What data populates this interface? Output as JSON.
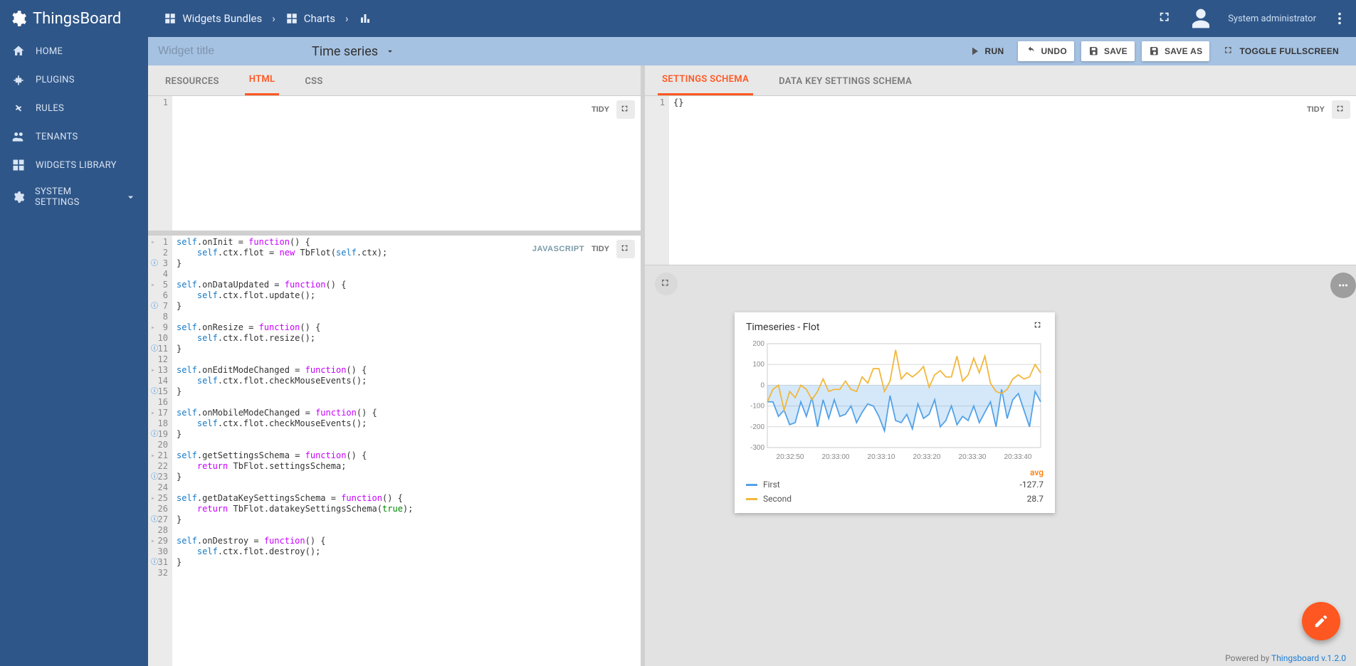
{
  "brand": "ThingsBoard",
  "user_label": "System administrator",
  "breadcrumb": {
    "bundles": "Widgets Bundles",
    "charts": "Charts"
  },
  "sidebar": {
    "home": "HOME",
    "plugins": "PLUGINS",
    "rules": "RULES",
    "tenants": "TENANTS",
    "widgets_library": "WIDGETS LIBRARY",
    "system_settings": "SYSTEM SETTINGS"
  },
  "toolbar": {
    "title_placeholder": "Widget title",
    "type": "Time series",
    "run": "RUN",
    "undo": "UNDO",
    "save": "SAVE",
    "save_as": "SAVE AS",
    "toggle_fs": "TOGGLE FULLSCREEN"
  },
  "left_tabs": {
    "resources": "RESOURCES",
    "html": "HTML",
    "css": "CSS",
    "active": "HTML"
  },
  "right_tabs": {
    "settings": "SETTINGS SCHEMA",
    "datakey": "DATA KEY SETTINGS SCHEMA",
    "active": "SETTINGS SCHEMA"
  },
  "pane": {
    "tidy": "TIDY",
    "js_tag": "JAVASCRIPT"
  },
  "schema_editor_content": "{}",
  "chart_data": {
    "title": "Timeseries - Flot",
    "type": "line",
    "ylim": [
      -300,
      200
    ],
    "yticks": [
      200,
      100,
      0,
      -100,
      -200,
      -300
    ],
    "xticks": [
      "20:32:50",
      "20:33:00",
      "20:33:10",
      "20:33:20",
      "20:33:30",
      "20:33:40"
    ],
    "legend_header": "avg",
    "series": [
      {
        "name": "First",
        "color": "#53a2e8",
        "fill": true,
        "avg": "-127.7",
        "values": [
          -80,
          -80,
          -150,
          -120,
          -190,
          -180,
          -80,
          -150,
          -60,
          -200,
          -70,
          -160,
          -70,
          -150,
          -140,
          -100,
          -180,
          -130,
          -90,
          -100,
          -150,
          -220,
          -50,
          -170,
          -180,
          -140,
          -210,
          -90,
          -160,
          -140,
          -70,
          -200,
          -170,
          -100,
          -190,
          -150,
          -170,
          -100,
          -180,
          -130,
          -80,
          -200,
          -20,
          -160,
          -70,
          -40,
          -120,
          -200,
          -30,
          -80
        ]
      },
      {
        "name": "Second",
        "color": "#f2b73c",
        "fill": false,
        "avg": "28.7",
        "values": [
          -80,
          -20,
          0,
          -120,
          -30,
          -60,
          0,
          -20,
          -70,
          -30,
          30,
          -30,
          -20,
          -20,
          20,
          -20,
          -30,
          40,
          10,
          80,
          80,
          -30,
          20,
          170,
          30,
          60,
          40,
          60,
          90,
          -10,
          50,
          70,
          40,
          40,
          140,
          20,
          50,
          130,
          60,
          140,
          10,
          -30,
          -40,
          -20,
          30,
          50,
          30,
          40,
          100,
          60
        ]
      }
    ]
  },
  "footer_prefix": "Powered by ",
  "footer_link": "Thingsboard v.1.2.0"
}
